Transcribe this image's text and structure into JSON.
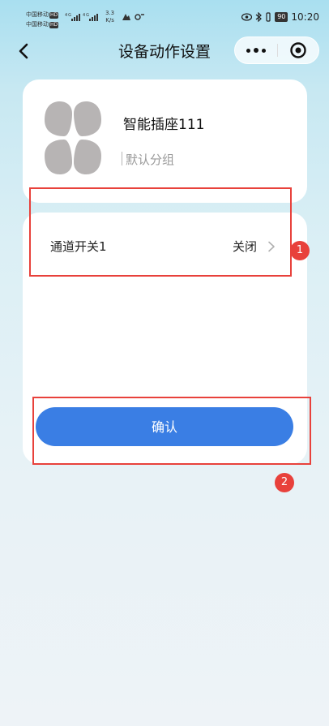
{
  "status_bar": {
    "carrier_line1": "中国移动",
    "carrier_line2": "中国移动",
    "hd_tag": "HD",
    "net_speed_value": "3.3",
    "net_speed_unit": "K/s",
    "battery": "90",
    "time": "10:20"
  },
  "nav": {
    "title": "设备动作设置"
  },
  "device": {
    "name": "智能插座111",
    "group": "默认分组"
  },
  "action": {
    "label": "通道开关1",
    "value": "关闭"
  },
  "confirm_label": "确认",
  "annotations": {
    "badge1": "1",
    "badge2": "2",
    "color": "#e8413b"
  },
  "colors": {
    "primary": "#3a7ee4",
    "icon_gray": "#b7b4b4"
  }
}
